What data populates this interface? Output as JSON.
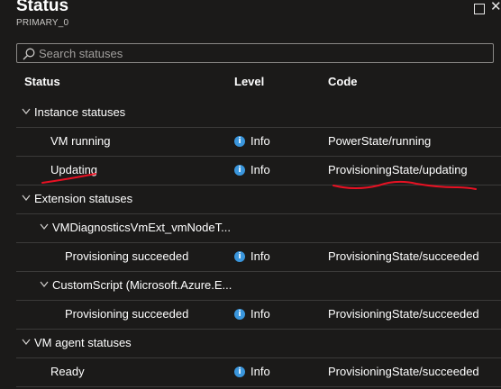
{
  "header": {
    "title": "Status",
    "subtitle": "PRIMARY_0"
  },
  "search": {
    "placeholder": "Search statuses",
    "value": ""
  },
  "columns": {
    "status": "Status",
    "level": "Level",
    "code": "Code"
  },
  "rows": [
    {
      "type": "group",
      "label": "Instance statuses",
      "expanded": true
    },
    {
      "type": "item",
      "label": "VM running",
      "level": "Info",
      "code": "PowerState/running"
    },
    {
      "type": "item",
      "label": "Updating",
      "level": "Info",
      "code": "ProvisioningState/updating"
    },
    {
      "type": "group",
      "label": "Extension statuses",
      "expanded": true
    },
    {
      "type": "subgroup",
      "label": "VMDiagnosticsVmExt_vmNodeT...",
      "expanded": true
    },
    {
      "type": "subitem",
      "label": "Provisioning succeeded",
      "level": "Info",
      "code": "ProvisioningState/succeeded"
    },
    {
      "type": "subgroup",
      "label": "CustomScript (Microsoft.Azure.E...",
      "expanded": true
    },
    {
      "type": "subitem",
      "label": "Provisioning succeeded",
      "level": "Info",
      "code": "ProvisioningState/succeeded"
    },
    {
      "type": "group",
      "label": "VM agent statuses",
      "expanded": true
    },
    {
      "type": "item",
      "label": "Ready",
      "level": "Info",
      "code": "ProvisioningState/succeeded"
    }
  ],
  "icons": {
    "info": "info-icon",
    "expand": "chevron-down-icon",
    "search": "search-icon"
  },
  "colors": {
    "background": "#1b1a19",
    "info": "#3a96dd",
    "annotation": "#e81123"
  }
}
